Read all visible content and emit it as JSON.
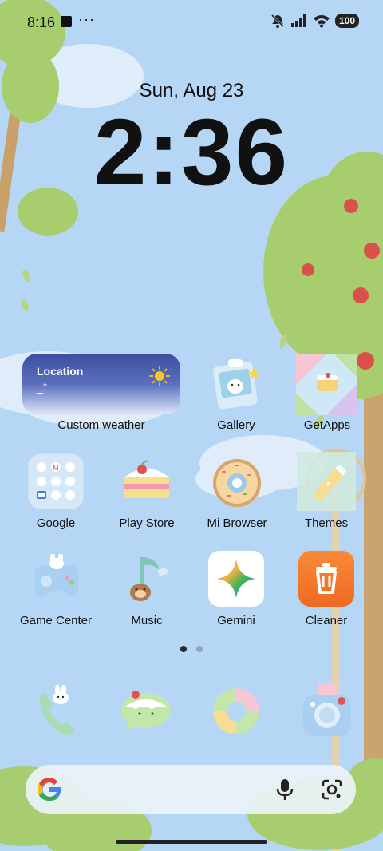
{
  "status_bar": {
    "time": "8:16",
    "more_indicator": "···",
    "battery": "100",
    "icons": [
      "notification-square-icon",
      "mute-icon",
      "signal-icon",
      "wifi-icon",
      "battery-icon"
    ]
  },
  "lock_clock": {
    "date": "Sun, Aug 23",
    "time": "2:36"
  },
  "weather_widget": {
    "location": "Location",
    "temperature": "_°",
    "label": "Custom weather",
    "icon": "sun-icon"
  },
  "apps": {
    "row1": [
      {
        "label": "Gallery",
        "icon": "gallery-icon"
      },
      {
        "label": "GetApps",
        "icon": "getapps-icon"
      }
    ],
    "row2": [
      {
        "label": "Google",
        "icon": "google-folder-icon"
      },
      {
        "label": "Play Store",
        "icon": "play-store-cake-icon"
      },
      {
        "label": "Mi Browser",
        "icon": "mi-browser-donut-icon"
      },
      {
        "label": "Themes",
        "icon": "themes-icon"
      }
    ],
    "row3": [
      {
        "label": "Game Center",
        "icon": "game-center-icon"
      },
      {
        "label": "Music",
        "icon": "music-icon"
      },
      {
        "label": "Gemini",
        "icon": "gemini-icon"
      },
      {
        "label": "Cleaner",
        "icon": "cleaner-trash-icon"
      }
    ]
  },
  "page_indicator": {
    "count": 2,
    "active": 1
  },
  "dock": [
    {
      "icon": "phone-icon"
    },
    {
      "icon": "messages-icon"
    },
    {
      "icon": "browser-donut-icon"
    },
    {
      "icon": "camera-icon"
    }
  ],
  "search_bar": {
    "logo": "google-g-logo",
    "mic": "microphone-icon",
    "lens": "lens-camera-icon"
  },
  "colors": {
    "sky": "#b5d6f5",
    "tree": "#a7cd6e",
    "cleaner": "#f47a2e",
    "weather_top": "#3e4fa0"
  }
}
